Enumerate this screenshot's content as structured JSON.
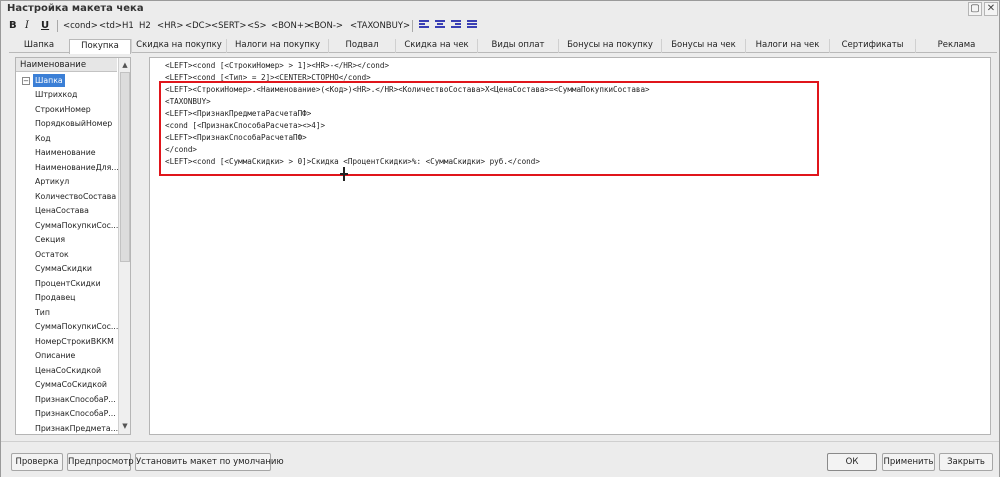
{
  "window": {
    "title": "Настройка макета чека",
    "restore_icon": "restore-icon",
    "close_icon": "close-icon"
  },
  "toolbar": {
    "bold": "B",
    "italic": "I",
    "underline": "U",
    "tags": [
      "<cond>",
      "<td>",
      "H1",
      "H2",
      "<HR>",
      "<DC>",
      "<SERT>",
      "<S>",
      "<BON+>",
      "<BON->",
      "<TAXONBUY>"
    ],
    "align_icons": [
      "align-left-icon",
      "align-center-icon",
      "align-right-icon",
      "align-justify-icon"
    ],
    "accent_color": "#3a3fb4"
  },
  "tabs": [
    "Шапка",
    "Покупка",
    "Скидка на покупку",
    "Налоги на покупку",
    "Подвал",
    "Скидка на чек",
    "Виды оплат",
    "Бонусы на покупку",
    "Бонусы на чек",
    "Налоги на чек",
    "Сертификаты",
    "Реклама"
  ],
  "active_tab": "Покупка",
  "sidebar": {
    "header": "Наименование",
    "root": "Шапка",
    "items": [
      "Штрихкод",
      "СтрокиНомер",
      "ПорядковыйНомер",
      "Код",
      "Наименование",
      "НаименованиеДля...",
      "Артикул",
      "КоличествоСостава",
      "ЦенаСостава",
      "СуммаПокупкиСос...",
      "Секция",
      "Остаток",
      "СуммаСкидки",
      "ПроцентСкидки",
      "Продавец",
      "Тип",
      "СуммаПокупкиСос...",
      "НомерСтрокиВККМ",
      "Описание",
      "ЦенаСоСкидкой",
      "СуммаСоСкидкой",
      "ПризнакСпособаР...",
      "ПризнакСпособаР...",
      "ПризнакПредмета..."
    ]
  },
  "editor": {
    "lines": [
      "<LEFT><cond [<СтрокиНомер> > 1]><HR>-</HR></cond>",
      "<LEFT><cond [<Тип> = 2]><CENTER>СТОРНО</cond>",
      "<LEFT><СтрокиНомер>.<Наименование>(<Код>)<HR>.</HR><КоличествоСостава>X<ЦенаСостава>=<СуммаПокупкиСостава>",
      "<TAXONBUY>",
      "<LEFT><ПризнакПредметаРасчетаПФ>",
      "<cond [<ПризнакСпособаРасчета><>4]>",
      "<LEFT><ПризнакСпособаРасчетаПФ>",
      "</cond>",
      "<LEFT><cond [<СуммаСкидки> > 0]>Скидка <ПроцентСкидки>%: <СуммаСкидки> руб.</cond>"
    ],
    "highlight_color": "#e0151b"
  },
  "buttons": {
    "check": "Проверка",
    "preview": "Предпросмотр",
    "set_default": "Установить макет по умолчанию",
    "ok": "ОК",
    "apply": "Применить",
    "close": "Закрыть"
  }
}
